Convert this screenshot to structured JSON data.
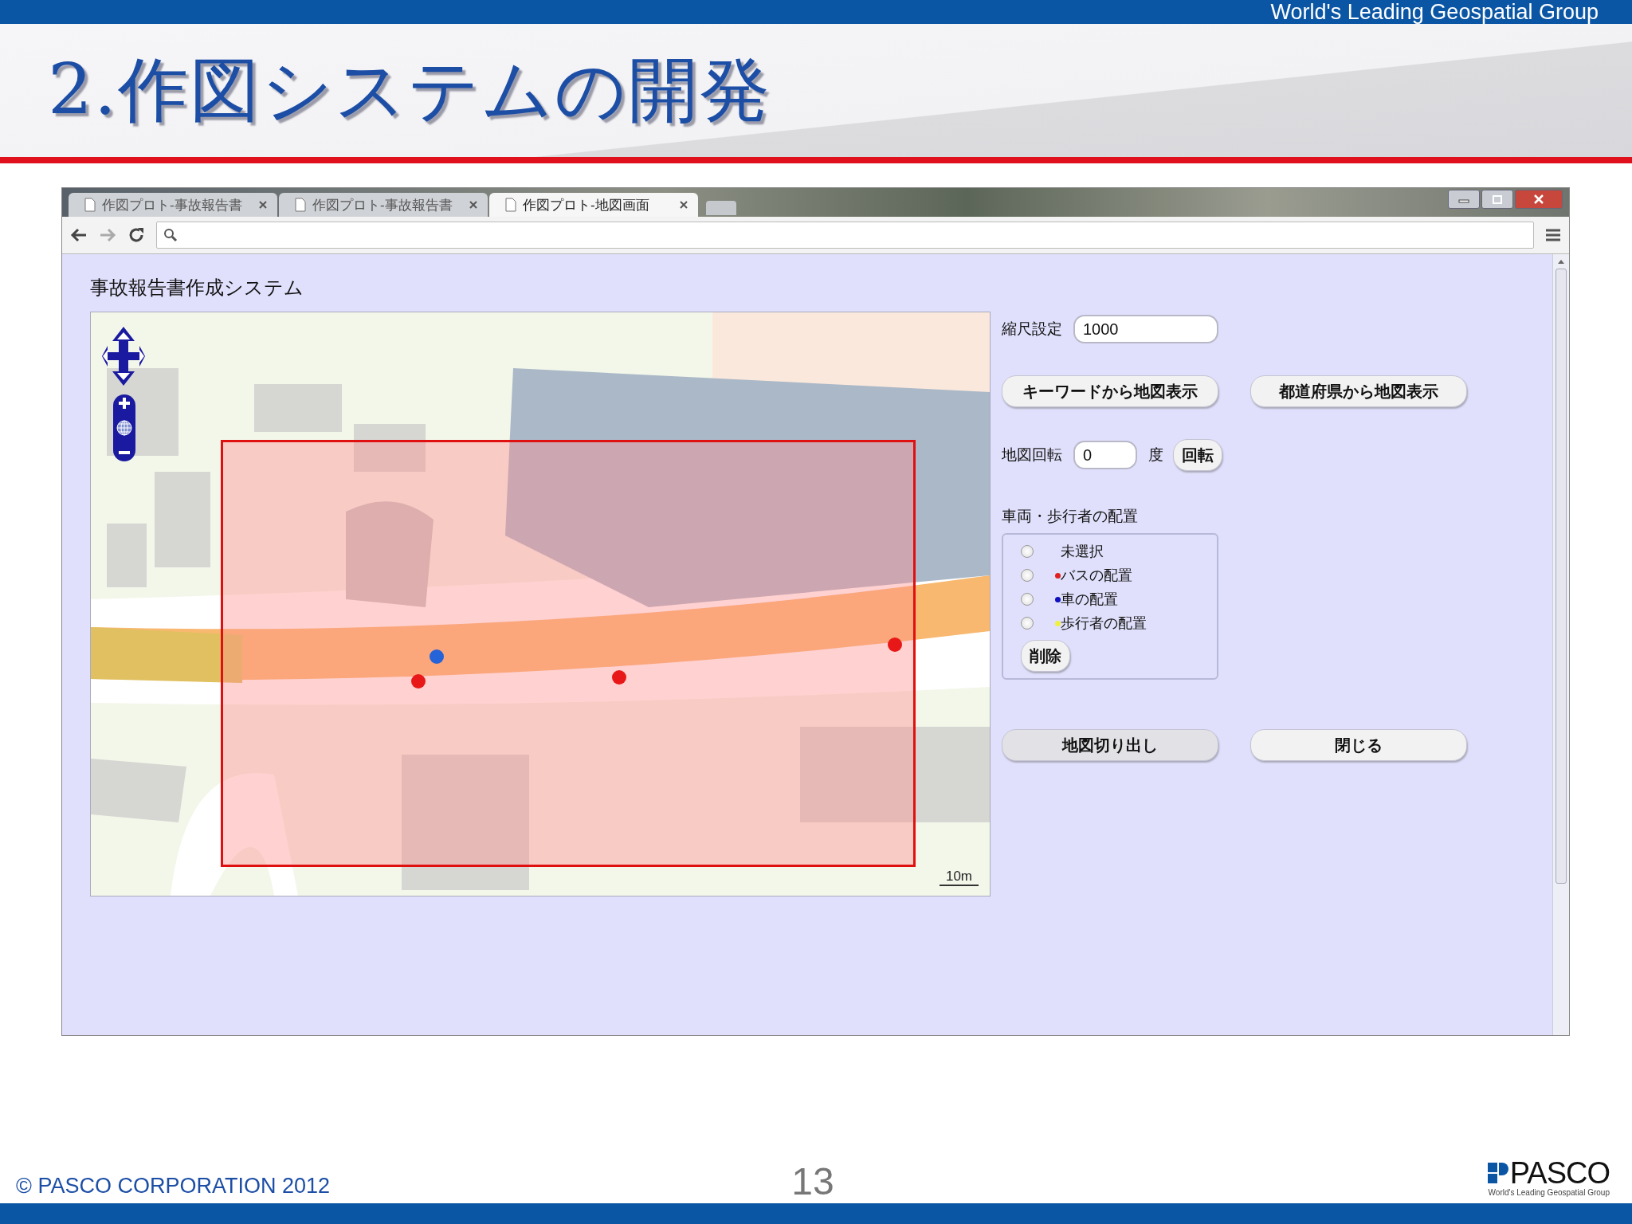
{
  "slide": {
    "tagline": "World's Leading Geospatial Group",
    "title": "2.作図システムの開発",
    "copyright": "© PASCO CORPORATION 2012",
    "page_number": "13",
    "logo": "PASCO",
    "logo_tagline": "World's Leading Geospatial Group"
  },
  "browser": {
    "tabs": [
      {
        "label": "作図プロト-事故報告書",
        "selected": false
      },
      {
        "label": "作図プロト-事故報告書",
        "selected": false
      },
      {
        "label": "作図プロト-地図画面",
        "selected": true
      }
    ]
  },
  "app": {
    "heading": "事故報告書作成システム",
    "map": {
      "scale_label": "10m",
      "markers": [
        {
          "color": "#2563d8"
        },
        {
          "color": "#e81818"
        },
        {
          "color": "#e81818"
        },
        {
          "color": "#e81818"
        }
      ]
    },
    "scale": {
      "label": "縮尺設定",
      "value": "1000"
    },
    "buttons_top": [
      "キーワードから地図表示",
      "都道府県から地図表示"
    ],
    "rotation": {
      "label": "地図回転",
      "value": "0",
      "unit": "度",
      "button": "回転"
    },
    "placement": {
      "label": "車両・歩行者の配置",
      "options": [
        {
          "label": "未選択",
          "selected": false
        },
        {
          "label": "バスの配置",
          "selected": false,
          "color": "#e02020"
        },
        {
          "label": "車の配置",
          "selected": false,
          "color": "#1010c0"
        },
        {
          "label": "歩行者の配置",
          "selected": false,
          "color": "#f0f040"
        }
      ],
      "delete_button": "削除"
    },
    "buttons_bottom": [
      "地図切り出し",
      "閉じる"
    ]
  }
}
